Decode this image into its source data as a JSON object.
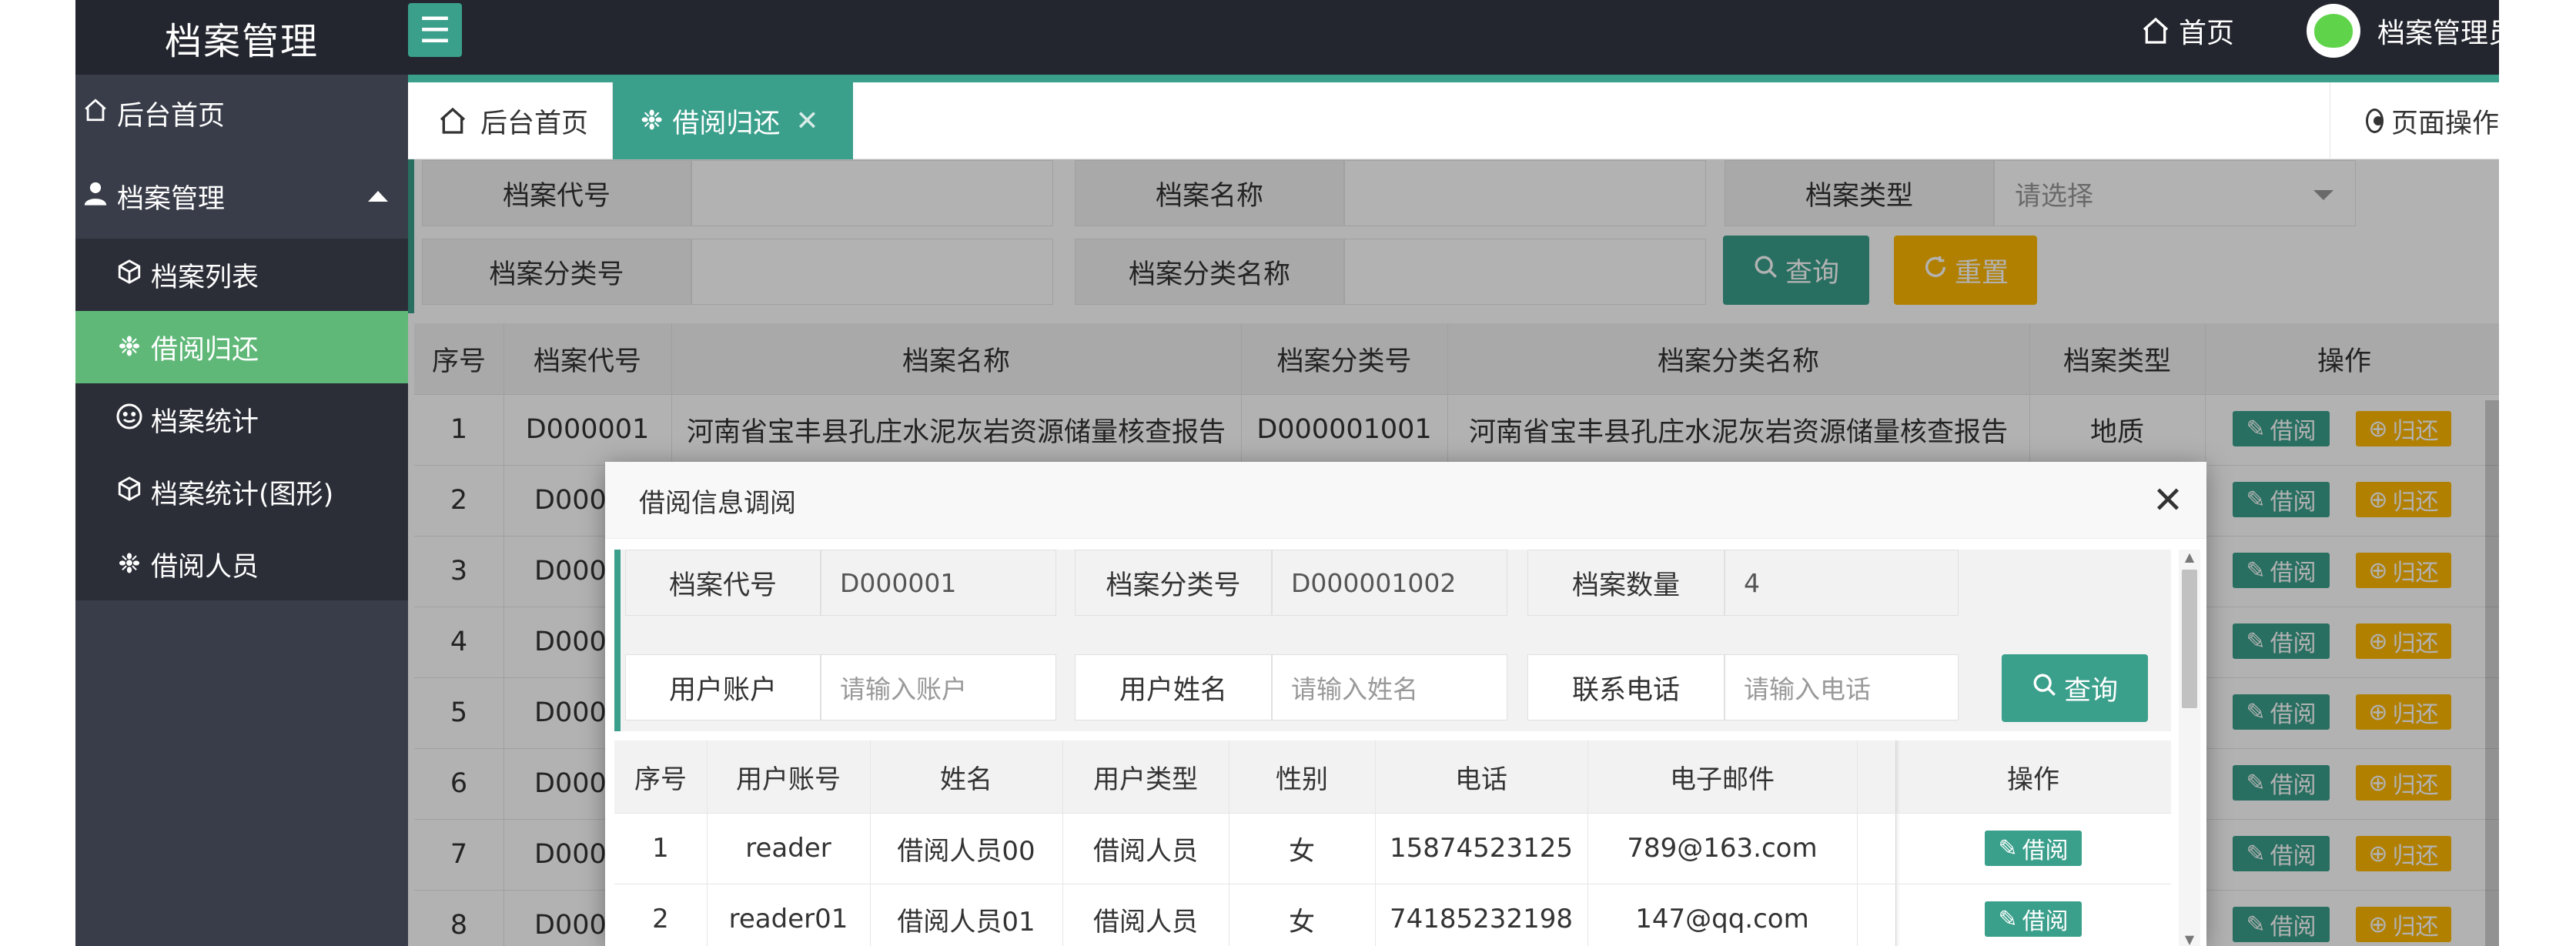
{
  "app": {
    "title": "档案管理",
    "home_link": "首页",
    "admin_name": "档案管理员"
  },
  "sidebar": {
    "items": [
      {
        "label": "后台首页",
        "icon": "home-icon"
      },
      {
        "label": "档案管理",
        "icon": "user-icon"
      },
      {
        "label": "档案列表",
        "icon": "cube-icon"
      },
      {
        "label": "借阅归还",
        "icon": "gear-icon"
      },
      {
        "label": "档案统计",
        "icon": "smile-icon"
      },
      {
        "label": "档案统计(图形)",
        "icon": "cube-icon"
      },
      {
        "label": "借阅人员",
        "icon": "gear-icon"
      }
    ]
  },
  "tabs": {
    "home": "后台首页",
    "borrow": "借阅归还",
    "page_ops": "页面操作"
  },
  "search": {
    "code_label": "档案代号",
    "name_label": "档案名称",
    "type_label": "档案类型",
    "type_placeholder": "请选择",
    "class_no_label": "档案分类号",
    "class_name_label": "档案分类名称",
    "query_btn": "查询",
    "reset_btn": "重置"
  },
  "table": {
    "headers": [
      "序号",
      "档案代号",
      "档案名称",
      "档案分类号",
      "档案分类名称",
      "档案类型",
      "操作"
    ],
    "row1": {
      "no": "1",
      "code": "D000001",
      "name": "河南省宝丰县孔庄水泥灰岩资源储量核查报告",
      "class_no": "D000001001",
      "class_name": "河南省宝丰县孔庄水泥灰岩资源储量核查报告",
      "type": "地质"
    },
    "visible_rows": [
      {
        "no": "2",
        "code": "D000"
      },
      {
        "no": "3",
        "code": "D000"
      },
      {
        "no": "4",
        "code": "D000"
      },
      {
        "no": "5",
        "code": "D000"
      },
      {
        "no": "6",
        "code": "D000"
      },
      {
        "no": "7",
        "code": "D000"
      },
      {
        "no": "8",
        "code": "D000"
      }
    ],
    "borrow_btn": "借阅",
    "return_btn": "归还"
  },
  "modal": {
    "title": "借阅信息调阅",
    "code_label": "档案代号",
    "code_value": "D000001",
    "class_no_label": "档案分类号",
    "class_no_value": "D000001002",
    "count_label": "档案数量",
    "count_value": "4",
    "account_label": "用户账户",
    "account_placeholder": "请输入账户",
    "username_label": "用户姓名",
    "username_placeholder": "请输入姓名",
    "phone_label": "联系电话",
    "phone_placeholder": "请输入电话",
    "query_btn": "查询",
    "headers": [
      "序号",
      "用户账号",
      "姓名",
      "用户类型",
      "性别",
      "电话",
      "电子邮件",
      "操作"
    ],
    "rows": [
      {
        "no": "1",
        "account": "reader",
        "name": "借阅人员00",
        "type": "借阅人员",
        "gender": "女",
        "phone": "15874523125",
        "email": "789@163.com"
      },
      {
        "no": "2",
        "account": "reader01",
        "name": "借阅人员01",
        "type": "借阅人员",
        "gender": "女",
        "phone": "74185232198",
        "email": "147@qq.com"
      }
    ],
    "borrow_btn": "借阅"
  },
  "colors": {
    "header_bg": "#23262e",
    "sidebar_bg": "#393d49",
    "accent": "#3a9f8b",
    "active_item": "#5fb878",
    "warning": "#ffb800"
  }
}
